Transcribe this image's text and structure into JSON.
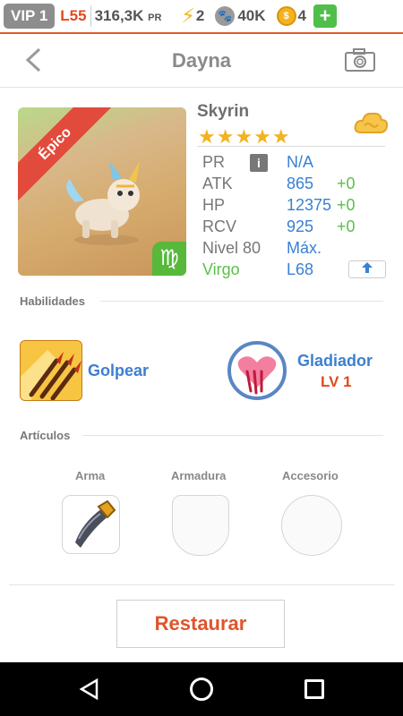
{
  "status_bar": {
    "vip": "VIP 1",
    "level": "L55",
    "power_value": "316,3K",
    "power_unit": "PR",
    "energy": "2",
    "paw_currency": "40K",
    "coin_currency": "4",
    "plus": "+"
  },
  "header": {
    "back": "<",
    "title": "Dayna"
  },
  "pet": {
    "rarity": "Épico",
    "zodiac_glyph": "♍",
    "name": "Skyrin",
    "stars": "★★★★★",
    "star_count": 5,
    "stats": [
      {
        "label": "PR",
        "value": "N/A",
        "bonus": ""
      },
      {
        "label": "ATK",
        "value": "865",
        "bonus": "+0"
      },
      {
        "label": "HP",
        "value": "12375",
        "bonus": "+0"
      },
      {
        "label": "RCV",
        "value": "925",
        "bonus": "+0"
      },
      {
        "label": "Nivel 80",
        "value": "Máx.",
        "bonus": ""
      },
      {
        "label": "Virgo",
        "value": "L68",
        "bonus": ""
      }
    ],
    "info": "i"
  },
  "abilities": {
    "section_title": "Habilidades",
    "skill": "Golpear",
    "trait": "Gladiador",
    "trait_level": "LV 1"
  },
  "articles": {
    "section_title": "Artículos",
    "slots": [
      "Arma",
      "Armadura",
      "Accesorio"
    ]
  },
  "actions": {
    "restore": "Restaurar"
  },
  "colors": {
    "accent_orange": "#e0542a",
    "link_blue": "#3a7fd3",
    "bonus_green": "#5bbf4a",
    "star_gold": "#f3b21e"
  }
}
